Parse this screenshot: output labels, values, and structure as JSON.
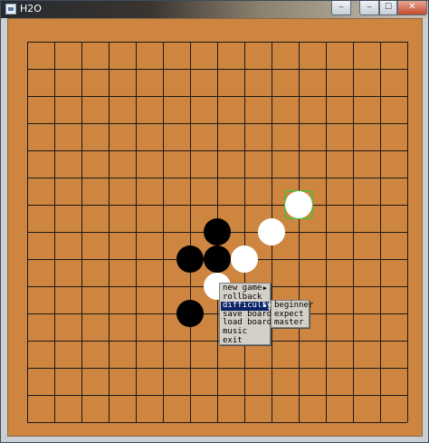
{
  "window": {
    "title": "H2O",
    "controls": {
      "minimize": "‒",
      "maximize": "☐",
      "close": "✕"
    }
  },
  "board": {
    "size": 14,
    "background": "#cd853f",
    "line_color": "#1a1a1a",
    "stones": [
      {
        "color": "black",
        "col": 7,
        "row": 7
      },
      {
        "color": "black",
        "col": 6,
        "row": 8
      },
      {
        "color": "black",
        "col": 7,
        "row": 8
      },
      {
        "color": "black",
        "col": 6,
        "row": 10
      },
      {
        "color": "white",
        "col": 10,
        "row": 6
      },
      {
        "color": "white",
        "col": 9,
        "row": 7
      },
      {
        "color": "white",
        "col": 8,
        "row": 8
      },
      {
        "color": "white",
        "col": 7,
        "row": 9
      }
    ],
    "last_move": {
      "col": 10,
      "row": 6,
      "marker_color": "#63b33a"
    }
  },
  "context_menu": {
    "items": [
      {
        "label": "new game",
        "has_submenu": true,
        "active": false
      },
      {
        "label": "rollback",
        "has_submenu": false,
        "active": false
      },
      {
        "label": "difficulty",
        "has_submenu": true,
        "active": true
      },
      {
        "label": "save board",
        "has_submenu": false,
        "active": false
      },
      {
        "label": "load board",
        "has_submenu": false,
        "active": false
      },
      {
        "label": "music",
        "has_submenu": false,
        "active": false
      },
      {
        "label": "exit",
        "has_submenu": false,
        "active": false
      }
    ],
    "submenu_arrow": "▶",
    "highlight_color": "#0a246a"
  },
  "difficulty_submenu": {
    "items": [
      {
        "label": "beginner"
      },
      {
        "label": "expect"
      },
      {
        "label": "master"
      }
    ]
  }
}
